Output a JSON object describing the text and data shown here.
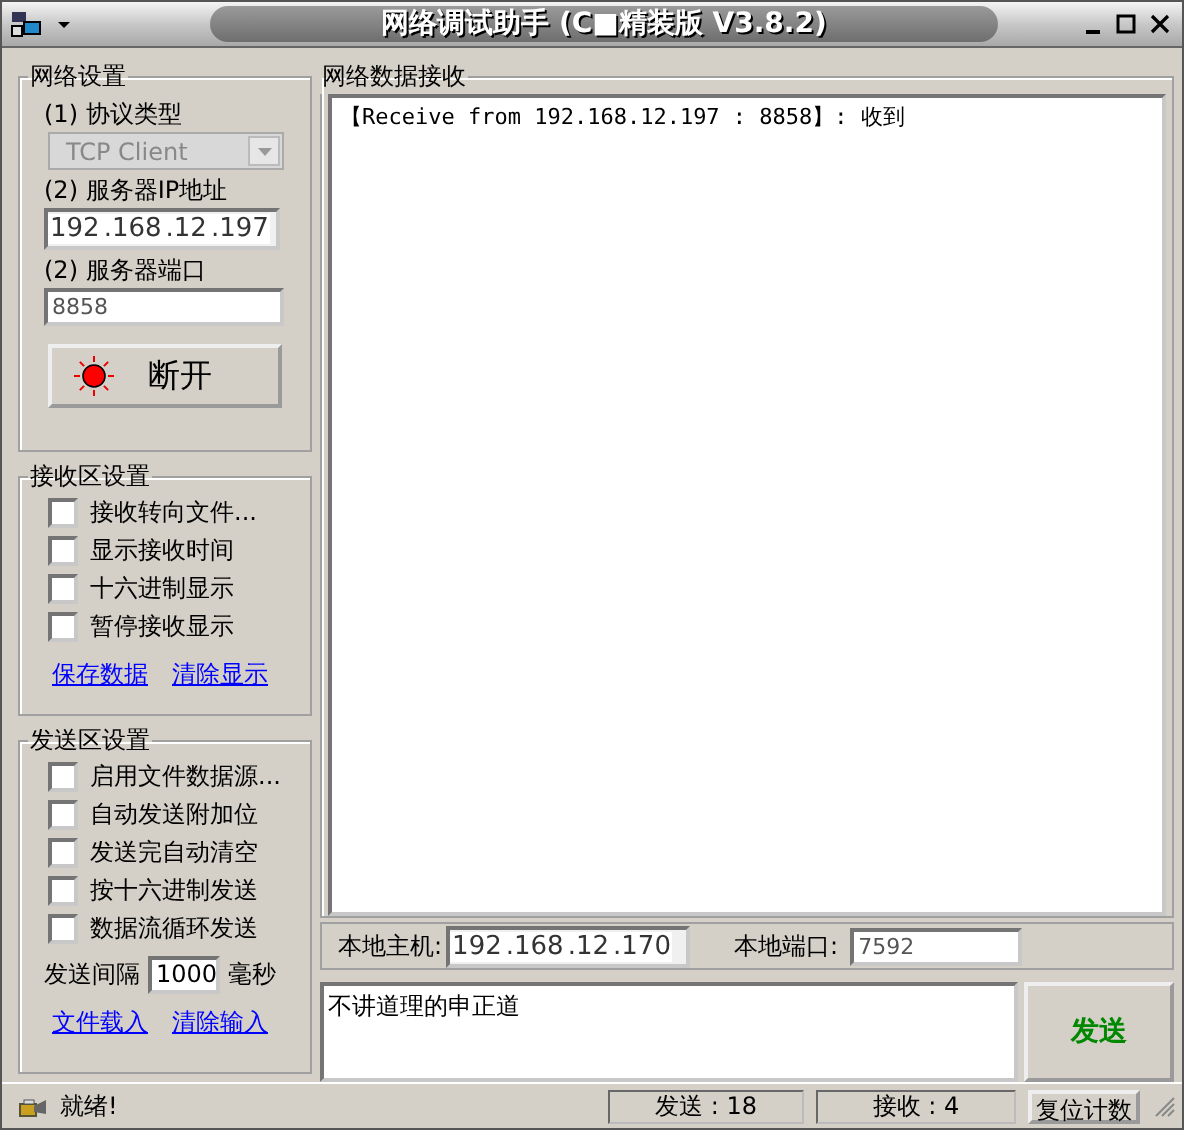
{
  "window": {
    "title": "网络调试助手 (C■精装版 V3.8.2)"
  },
  "network_settings": {
    "title": "网络设置",
    "protocol_label": "(1) 协议类型",
    "protocol": "TCP Client",
    "ip_label": "(2) 服务器IP地址",
    "ip": [
      "192",
      ".168",
      ".12",
      ".197"
    ],
    "port_label": "(2) 服务器端口",
    "port": "8858",
    "connect_button": "断开"
  },
  "receive_settings": {
    "title": "接收区设置",
    "options": [
      {
        "label": "接收转向文件...",
        "checked": false
      },
      {
        "label": "显示接收时间",
        "checked": false
      },
      {
        "label": "十六进制显示",
        "checked": false
      },
      {
        "label": "暂停接收显示",
        "checked": false
      }
    ],
    "links": [
      "保存数据",
      "清除显示"
    ]
  },
  "send_settings": {
    "title": "发送区设置",
    "options": [
      {
        "label": "启用文件数据源...",
        "checked": false
      },
      {
        "label": "自动发送附加位",
        "checked": false
      },
      {
        "label": "发送完自动清空",
        "checked": false
      },
      {
        "label": "按十六进制发送",
        "checked": false
      },
      {
        "label": "数据流循环发送",
        "checked": false
      }
    ],
    "interval_label": "发送间隔",
    "interval": "1000",
    "interval_unit": "毫秒",
    "links": [
      "文件载入",
      "清除输入"
    ]
  },
  "receive_area": {
    "title": "网络数据接收",
    "text": "【Receive from 192.168.12.197 : 8858】: 收到"
  },
  "local": {
    "host_label": "本地主机:",
    "host_ip": [
      "192",
      ".168",
      ".12",
      ".170"
    ],
    "port_label": "本地端口:",
    "port": "7592"
  },
  "send_input": {
    "value": "不讲道理的申正道"
  },
  "send_button": "发送",
  "status_bar": {
    "message": "就绪!",
    "sent": "发送 : 18",
    "received": "接收 : 4",
    "reset_button": "复位计数"
  }
}
